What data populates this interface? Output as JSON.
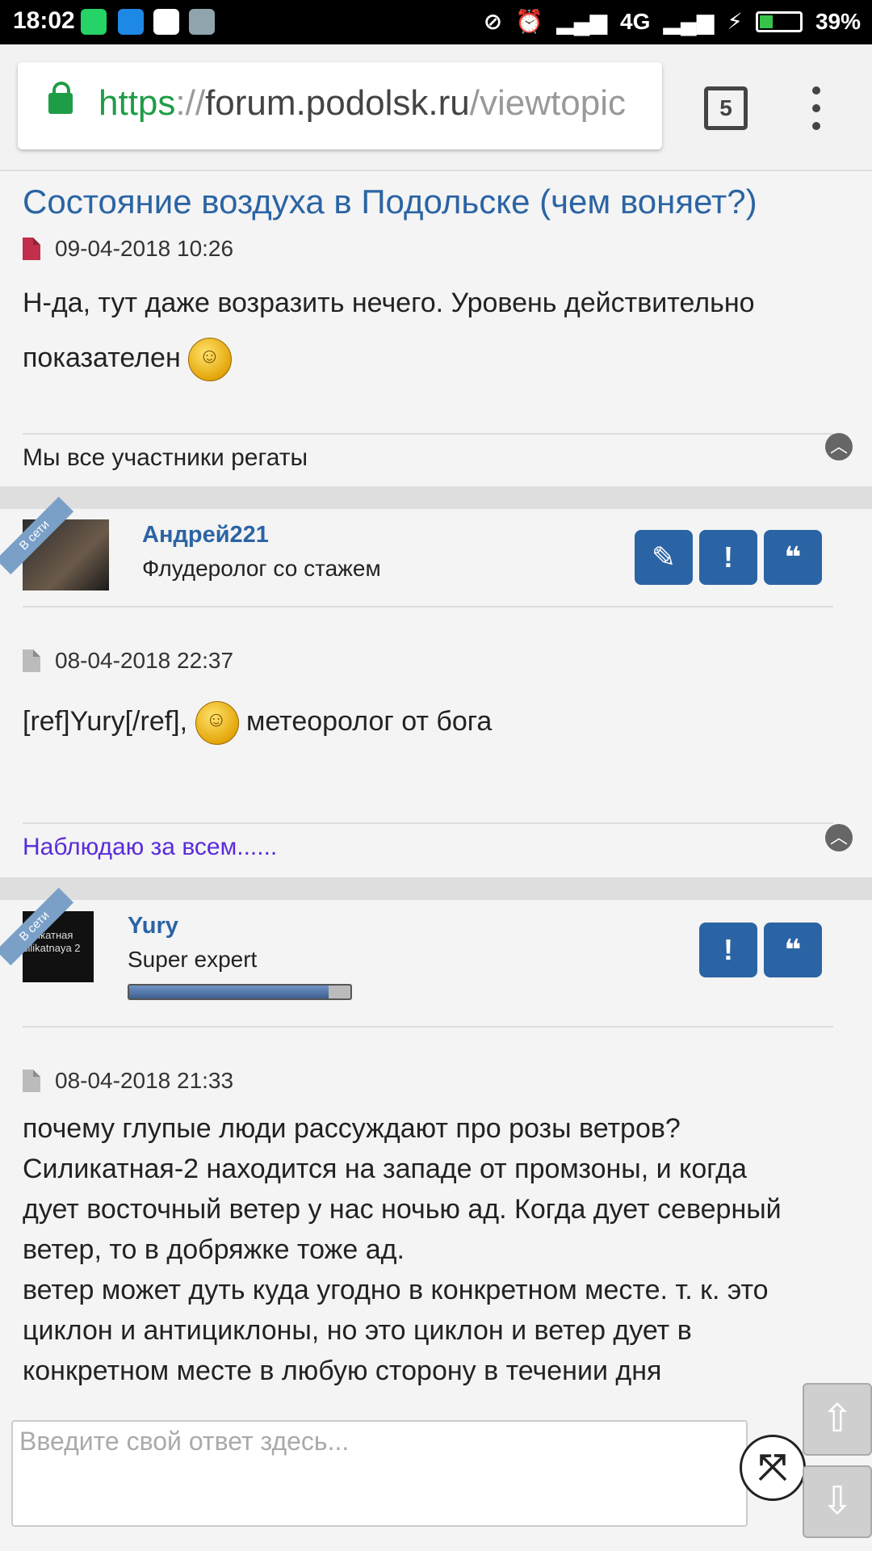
{
  "statusbar": {
    "time": "18:02",
    "network": "4G",
    "battery": "39%",
    "battery_level": 0.39,
    "app_icons": [
      "whatsapp-icon",
      "files-icon",
      "google-icon",
      "notes-icon"
    ]
  },
  "browser": {
    "url_scheme": "https",
    "url_sep": "://",
    "url_host": "forum.podolsk.ru",
    "url_path": "/viewtopic",
    "tab_count": "5"
  },
  "topic": {
    "title": "Состояние воздуха в Подольске (чем воняет?)"
  },
  "posts": [
    {
      "date": "09-04-2018 10:26",
      "text_line1": "Н-да, тут даже возразить нечего. Уровень действительно",
      "text_line2": "показателен",
      "signature": "Мы все участники регаты"
    },
    {
      "username": "Андрей221",
      "rank": "Флудеролог со стажем",
      "online_badge": "В сети",
      "date": "08-04-2018 22:37",
      "text_before": "[ref]Yury[/ref],",
      "text_after": "метеоролог от бога",
      "signature": "Наблюдаю за всем......"
    },
    {
      "username": "Yury",
      "rank": "Super expert",
      "online_badge": "В сети",
      "avatar_text": "иликатная\nsilikatnaya 2",
      "rank_progress": 0.9,
      "date": "08-04-2018 21:33",
      "lines": [
        "почему глупые люди рассуждают про розы ветров?",
        "Силикатная-2 находится на западе от промзоны, и когда",
        "дует восточный ветер у нас ночью ад. Когда дует северный",
        "ветер, то в добряжке тоже ад.",
        "ветер может дуть куда угодно в конкретном месте. т. к. это",
        "циклон и антициклоны, но это циклон и ветер дует в",
        "конкретном месте в любую сторону в течении дня"
      ]
    }
  ],
  "buttons": {
    "edit": "✎",
    "report": "!",
    "quote": "❝",
    "up_arrow": "⇧",
    "down_arrow": "⇩",
    "collapse": "︿",
    "expand": "⤧"
  },
  "reply": {
    "placeholder": "Введите свой ответ здесь..."
  }
}
